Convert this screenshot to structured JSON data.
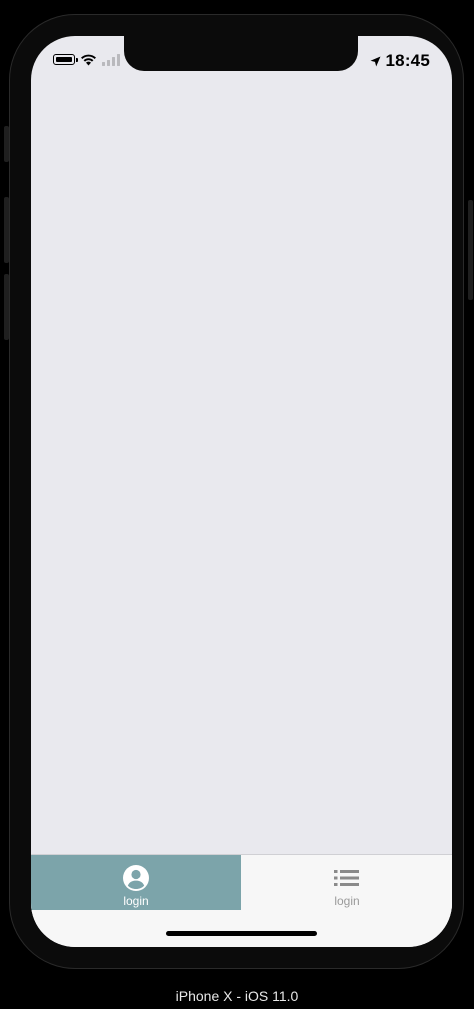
{
  "status_bar": {
    "time": "18:45",
    "icons": [
      "battery-icon",
      "wifi-icon",
      "cellular-signal-icon",
      "location-arrow-icon"
    ]
  },
  "tab_bar": {
    "tabs": [
      {
        "label": "login",
        "icon": "account-circle-icon",
        "selected": true
      },
      {
        "label": "login",
        "icon": "list-icon",
        "selected": false
      }
    ],
    "active_color": "#7ca4aa",
    "background_color": "#f7f7f7"
  },
  "content": {
    "background_color": "#e9e9ee"
  },
  "device": {
    "caption": "iPhone X - iOS 11.0"
  }
}
